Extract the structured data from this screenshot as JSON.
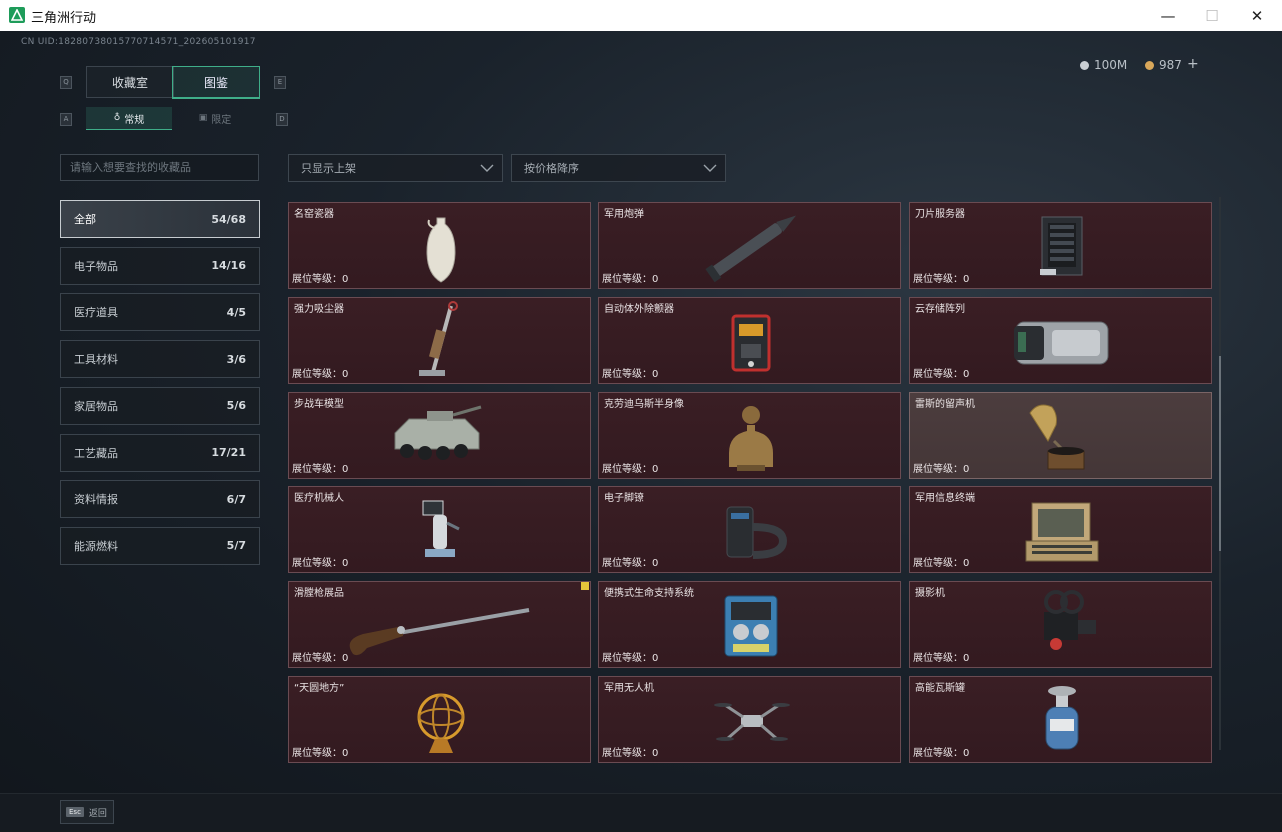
{
  "window": {
    "title": "三角洲行动",
    "minimize": "—",
    "maximize": "☐",
    "close": "✕"
  },
  "header": {
    "uid": "CN UID:18280738015770714571_202605101917",
    "currency": [
      {
        "value": "100M",
        "color": "#c9ced3"
      },
      {
        "value": "987",
        "color": "#d8a75a"
      }
    ],
    "add": "+"
  },
  "tabs": [
    {
      "label": "收藏室",
      "active": false
    },
    {
      "label": "图鉴",
      "active": true
    }
  ],
  "tab_keys": {
    "left": "Q",
    "right": "E",
    "sub_left": "A",
    "sub_right": "D"
  },
  "subtabs": [
    {
      "label": "常规",
      "icon": "bottle-icon",
      "active": true
    },
    {
      "label": "限定",
      "icon": "box-icon",
      "active": false
    }
  ],
  "search": {
    "placeholder": "请输入想要查找的收藏品"
  },
  "filters": {
    "shelf": "只显示上架",
    "sort": "按价格降序"
  },
  "categories": [
    {
      "label": "全部",
      "count": "54/68",
      "active": true
    },
    {
      "label": "电子物品",
      "count": "14/16"
    },
    {
      "label": "医疗道具",
      "count": "4/5"
    },
    {
      "label": "工具材料",
      "count": "3/6"
    },
    {
      "label": "家居物品",
      "count": "5/6"
    },
    {
      "label": "工艺藏品",
      "count": "17/21"
    },
    {
      "label": "资料情报",
      "count": "6/7"
    },
    {
      "label": "能源燃料",
      "count": "5/7"
    }
  ],
  "level_label": "展位等级：",
  "items": [
    {
      "name": "名窑瓷器",
      "level": "0",
      "icon": "vase-icon"
    },
    {
      "name": "军用炮弹",
      "level": "0",
      "icon": "shell-icon"
    },
    {
      "name": "刀片服务器",
      "level": "0",
      "icon": "server-icon"
    },
    {
      "name": "强力吸尘器",
      "level": "0",
      "icon": "vacuum-icon"
    },
    {
      "name": "自动体外除颤器",
      "level": "0",
      "icon": "defibrillator-icon"
    },
    {
      "name": "云存储阵列",
      "level": "0",
      "icon": "storage-array-icon"
    },
    {
      "name": "步战车模型",
      "level": "0",
      "icon": "armored-vehicle-icon"
    },
    {
      "name": "克劳迪乌斯半身像",
      "level": "0",
      "icon": "bust-icon"
    },
    {
      "name": "雷斯的留声机",
      "level": "0",
      "icon": "gramophone-icon",
      "light": true
    },
    {
      "name": "医疗机械人",
      "level": "0",
      "icon": "medical-robot-icon"
    },
    {
      "name": "电子脚镣",
      "level": "0",
      "icon": "ankle-monitor-icon"
    },
    {
      "name": "军用信息终端",
      "level": "0",
      "icon": "terminal-icon"
    },
    {
      "name": "滑膛枪展品",
      "level": "0",
      "icon": "musket-icon",
      "badge": true
    },
    {
      "name": "便携式生命支持系统",
      "level": "0",
      "icon": "life-support-icon"
    },
    {
      "name": "摄影机",
      "level": "0",
      "icon": "camera-icon"
    },
    {
      "name": "“天圆地方”",
      "level": "0",
      "icon": "armillary-sphere-icon"
    },
    {
      "name": "军用无人机",
      "level": "0",
      "icon": "drone-icon"
    },
    {
      "name": "高能瓦斯罐",
      "level": "0",
      "icon": "gas-canister-icon"
    }
  ],
  "footer": {
    "esc_key": "Esc",
    "back_label": "返回"
  }
}
